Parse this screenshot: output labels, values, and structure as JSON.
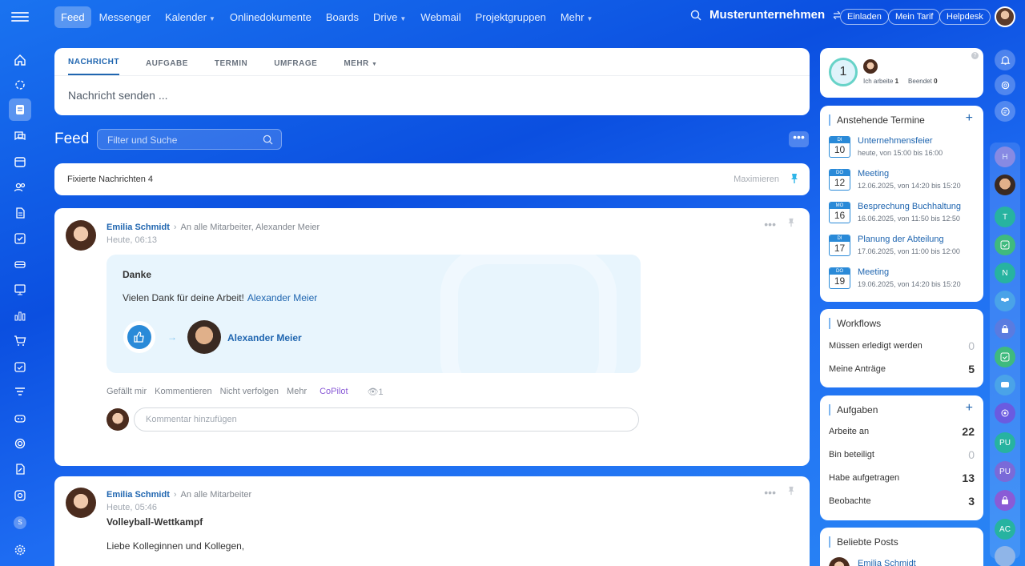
{
  "topbar": {
    "nav": [
      {
        "label": "Feed",
        "active": true,
        "caret": false
      },
      {
        "label": "Messenger",
        "active": false,
        "caret": false
      },
      {
        "label": "Kalender",
        "active": false,
        "caret": true
      },
      {
        "label": "Onlinedokumente",
        "active": false,
        "caret": false
      },
      {
        "label": "Boards",
        "active": false,
        "caret": false
      },
      {
        "label": "Drive",
        "active": false,
        "caret": true
      },
      {
        "label": "Webmail",
        "active": false,
        "caret": false
      },
      {
        "label": "Projektgruppen",
        "active": false,
        "caret": false
      },
      {
        "label": "Mehr",
        "active": false,
        "caret": true
      }
    ],
    "company": "Musterunternehmen",
    "invite": "Einladen",
    "plan": "Mein Tarif",
    "help": "Helpdesk"
  },
  "composer": {
    "tabs": [
      "NACHRICHT",
      "AUFGABE",
      "TERMIN",
      "UMFRAGE",
      "MEHR"
    ],
    "placeholder": "Nachricht senden ..."
  },
  "feed": {
    "title": "Feed",
    "search_placeholder": "Filter und Suche",
    "pinned_label": "Fixierte Nachrichten",
    "pinned_count": "4",
    "maximize": "Maximieren"
  },
  "post1": {
    "author": "Emilia Schmidt",
    "recipients": "An alle Mitarbeiter, Alexander Meier",
    "time": "Heute, 06:13",
    "thanks_title": "Danke",
    "thanks_text": "Vielen Dank für deine Arbeit!",
    "thanks_link": "Alexander Meier",
    "recipient_name": "Alexander Meier",
    "actions": {
      "like": "Gefällt mir",
      "comment": "Kommentieren",
      "unfollow": "Nicht verfolgen",
      "more": "Mehr",
      "copilot": "CoPilot",
      "views": "1"
    },
    "comment_placeholder": "Kommentar hinzufügen"
  },
  "post2": {
    "author": "Emilia Schmidt",
    "recipients": "An alle Mitarbeiter",
    "time": "Heute, 05:46",
    "title": "Volleyball-Wettkampf",
    "text": "Liebe Kolleginnen und Kollegen,"
  },
  "work": {
    "count": "1",
    "working_label": "Ich arbeite",
    "working_count": "1",
    "finished_label": "Beendet",
    "finished_count": "0"
  },
  "events": {
    "title": "Anstehende Termine",
    "items": [
      {
        "dow": "DI",
        "day": "10",
        "title": "Unternehmensfeier",
        "time": "heute, von 15:00 bis 16:00"
      },
      {
        "dow": "DO",
        "day": "12",
        "title": "Meeting",
        "time": "12.06.2025, von 14:20 bis 15:20"
      },
      {
        "dow": "MO",
        "day": "16",
        "title": "Besprechung Buchhaltung",
        "time": "16.06.2025, von 11:50 bis 12:50"
      },
      {
        "dow": "DI",
        "day": "17",
        "title": "Planung der Abteilung",
        "time": "17.06.2025, von 11:00 bis 12:00"
      },
      {
        "dow": "DO",
        "day": "19",
        "title": "Meeting",
        "time": "19.06.2025, von 14:20 bis 15:20"
      }
    ]
  },
  "workflows": {
    "title": "Workflows",
    "rows": [
      {
        "label": "Müssen erledigt werden",
        "value": "0"
      },
      {
        "label": "Meine Anträge",
        "value": "5"
      }
    ]
  },
  "tasks": {
    "title": "Aufgaben",
    "rows": [
      {
        "label": "Arbeite an",
        "value": "22"
      },
      {
        "label": "Bin beteiligt",
        "value": "0"
      },
      {
        "label": "Habe aufgetragen",
        "value": "13"
      },
      {
        "label": "Beobachte",
        "value": "3"
      }
    ]
  },
  "popular": {
    "title": "Beliebte Posts",
    "author": "Emilia Schmidt"
  },
  "rightbar": {
    "initials": [
      "H",
      "T",
      "N",
      "PU",
      "PU",
      "AC"
    ]
  },
  "leftbar": {
    "badge": "S"
  }
}
